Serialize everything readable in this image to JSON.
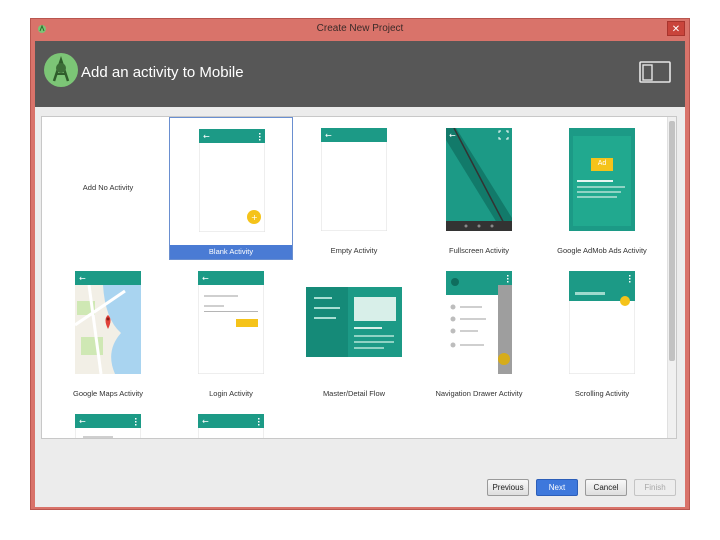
{
  "window": {
    "title": "Create New Project",
    "close_glyph": "✕"
  },
  "header": {
    "title": "Add an activity to Mobile"
  },
  "templates": [
    {
      "label": "Add No Activity"
    },
    {
      "label": "Blank Activity",
      "selected": true
    },
    {
      "label": "Empty Activity"
    },
    {
      "label": "Fullscreen Activity"
    },
    {
      "label": "Google AdMob Ads Activity",
      "ad_badge": "Ad"
    },
    {
      "label": "Google Maps Activity"
    },
    {
      "label": "Login Activity"
    },
    {
      "label": "Master/Detail Flow"
    },
    {
      "label": "Navigation Drawer Activity"
    },
    {
      "label": "Scrolling Activity"
    }
  ],
  "buttons": {
    "previous": "Previous",
    "next": "Next",
    "cancel": "Cancel",
    "finish": "Finish"
  },
  "colors": {
    "teal": "#1c9a86",
    "teal_dark": "#0f7f6d",
    "accent": "#f5c31a",
    "selection": "#4a7bd4"
  }
}
